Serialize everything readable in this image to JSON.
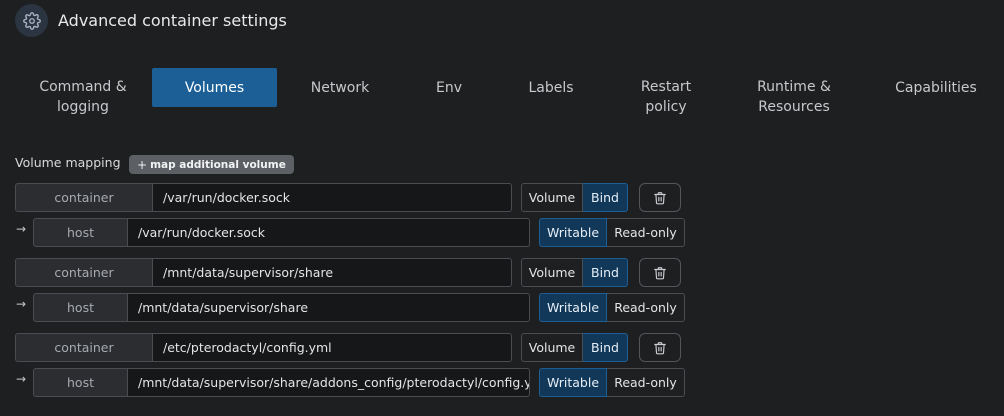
{
  "header": {
    "title": "Advanced container settings",
    "icon": "gear-icon"
  },
  "tabs": [
    {
      "label": "Command & logging"
    },
    {
      "label": "Volumes"
    },
    {
      "label": "Network"
    },
    {
      "label": "Env"
    },
    {
      "label": "Labels"
    },
    {
      "label": "Restart policy"
    },
    {
      "label": "Runtime & Resources"
    },
    {
      "label": "Capabilities"
    }
  ],
  "active_tab": "Volumes",
  "volumes": {
    "section_label": "Volume mapping",
    "add_button": {
      "plus": "+",
      "label": "map additional volume"
    },
    "type_options": [
      "Volume",
      "Bind"
    ],
    "mode_options": [
      "Writable",
      "Read-only"
    ],
    "container_prefix": "container",
    "host_prefix": "host",
    "arrow": "→",
    "mappings": [
      {
        "container": "/var/run/docker.sock",
        "host": "/var/run/docker.sock",
        "type": "Bind",
        "mode": "Writable"
      },
      {
        "container": "/mnt/data/supervisor/share",
        "host": "/mnt/data/supervisor/share",
        "type": "Bind",
        "mode": "Writable"
      },
      {
        "container": "/etc/pterodactyl/config.yml",
        "host": "/mnt/data/supervisor/share/addons_config/pterodactyl/config.yml",
        "type": "Bind",
        "mode": "Writable"
      }
    ]
  },
  "colors": {
    "accent": "#1b5f96",
    "selected_segment": "#113859",
    "background": "#1e1f21"
  }
}
